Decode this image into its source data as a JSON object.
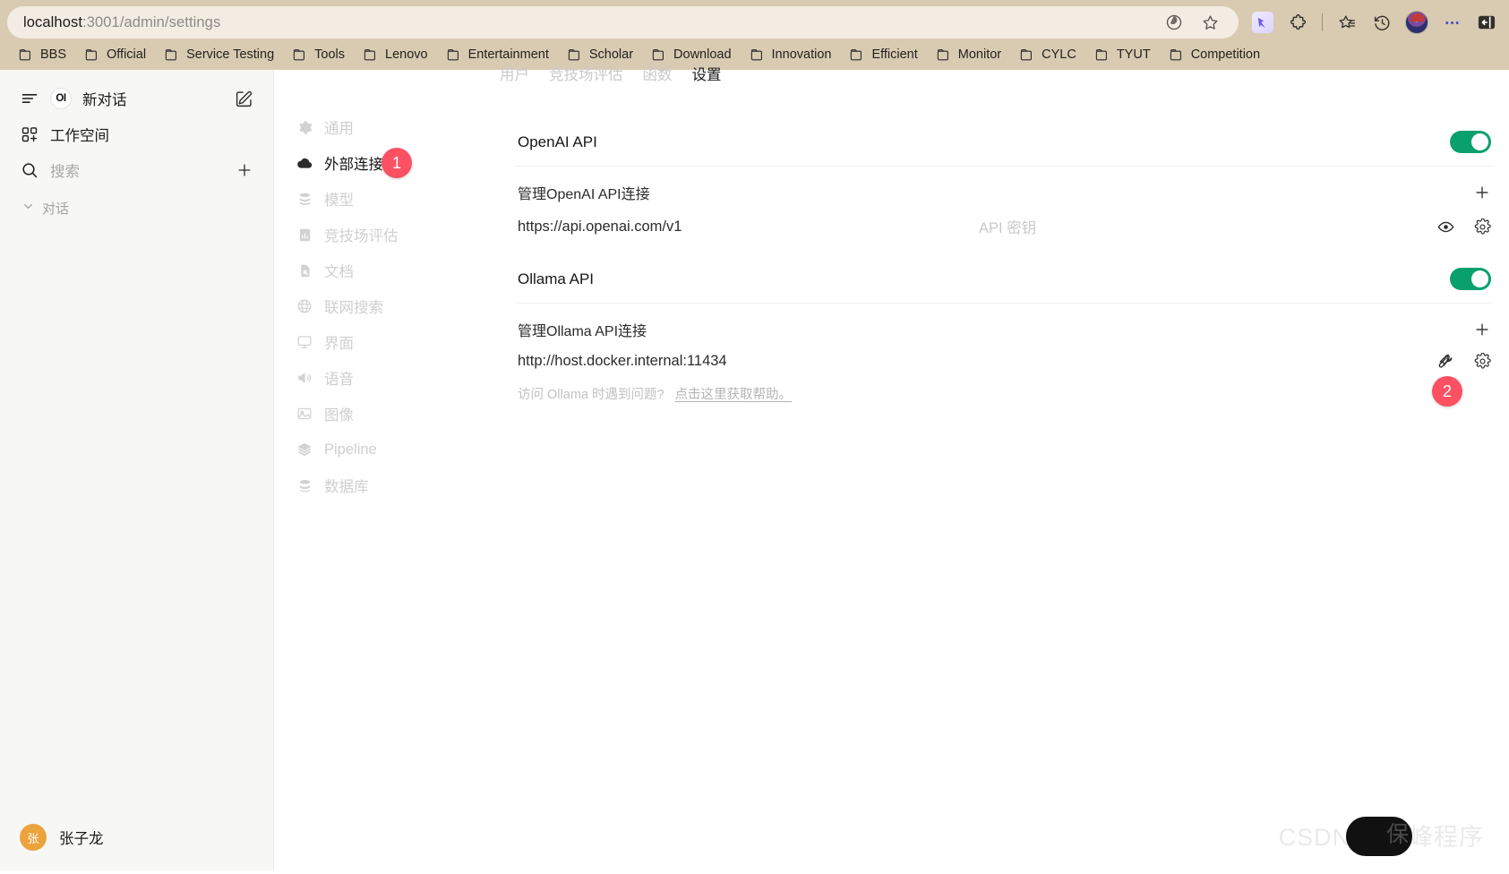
{
  "browser": {
    "url_host": "localhost",
    "url_path": ":3001/admin/settings",
    "omnibox_icons": [
      "edge-copilot-icon",
      "star-favorite-icon"
    ],
    "toolbar_icons": [
      "extension-blue-icon",
      "puzzle-extensions-icon",
      "favorites-list-icon",
      "history-icon",
      "profile-avatar-icon",
      "more-options-icon",
      "collapse-sidebar-icon"
    ],
    "bookmarks": [
      {
        "label": "BBS"
      },
      {
        "label": "Official"
      },
      {
        "label": "Service Testing"
      },
      {
        "label": "Tools"
      },
      {
        "label": "Lenovo"
      },
      {
        "label": "Entertainment"
      },
      {
        "label": "Scholar"
      },
      {
        "label": "Download"
      },
      {
        "label": "Innovation"
      },
      {
        "label": "Efficient"
      },
      {
        "label": "Monitor"
      },
      {
        "label": "CYLC"
      },
      {
        "label": "TYUT"
      },
      {
        "label": "Competition"
      }
    ]
  },
  "sidebar": {
    "logo_text": "OI",
    "new_chat": "新对话",
    "workspace": "工作空间",
    "search_placeholder": "搜索",
    "chats_group": "对话",
    "user": {
      "initial": "张",
      "name": "张子龙"
    }
  },
  "settings_nav": {
    "items": [
      {
        "label": "通用",
        "icon": "gear-icon",
        "active": false
      },
      {
        "label": "外部连接",
        "icon": "cloud-icon",
        "active": true,
        "badge": "1"
      },
      {
        "label": "模型",
        "icon": "database-icon",
        "active": false
      },
      {
        "label": "竞技场评估",
        "icon": "chart-bar-icon",
        "active": false
      },
      {
        "label": "文档",
        "icon": "document-search-icon",
        "active": false
      },
      {
        "label": "联网搜索",
        "icon": "globe-icon",
        "active": false
      },
      {
        "label": "界面",
        "icon": "monitor-icon",
        "active": false
      },
      {
        "label": "语音",
        "icon": "speaker-icon",
        "active": false
      },
      {
        "label": "图像",
        "icon": "image-icon",
        "active": false
      },
      {
        "label": "Pipeline",
        "icon": "layers-icon",
        "active": false
      },
      {
        "label": "数据库",
        "icon": "database-stack-icon",
        "active": false
      }
    ]
  },
  "tabs": [
    {
      "label": "用户",
      "active": false
    },
    {
      "label": "竞技场评估",
      "active": false
    },
    {
      "label": "函数",
      "active": false
    },
    {
      "label": "设置",
      "active": true
    }
  ],
  "main": {
    "openai": {
      "title": "OpenAI API",
      "enabled": true,
      "manage_label": "管理OpenAI API连接",
      "add_icon": "plus-icon",
      "url": "https://api.openai.com/v1",
      "key_placeholder": "API 密钥",
      "icons": [
        "eye-visibility-icon",
        "gear-settings-icon"
      ]
    },
    "ollama": {
      "title": "Ollama API",
      "enabled": true,
      "manage_label": "管理Ollama API连接",
      "add_icon": "plus-icon",
      "url": "http://host.docker.internal:11434",
      "icons": [
        "wrench-icon",
        "gear-settings-icon"
      ],
      "badge": "2",
      "help_text": "访问 Ollama 时遇到问题?",
      "help_link": "点击这里获取帮助。"
    }
  },
  "watermark": {
    "text": "CSDN @巅峰程序",
    "overlay_text": "保"
  },
  "colors": {
    "toggle_on": "#0aa06e",
    "badge_red": "#fc5162",
    "avatar_orange": "#eca33d",
    "chrome_tan": "#d9cbb2"
  }
}
